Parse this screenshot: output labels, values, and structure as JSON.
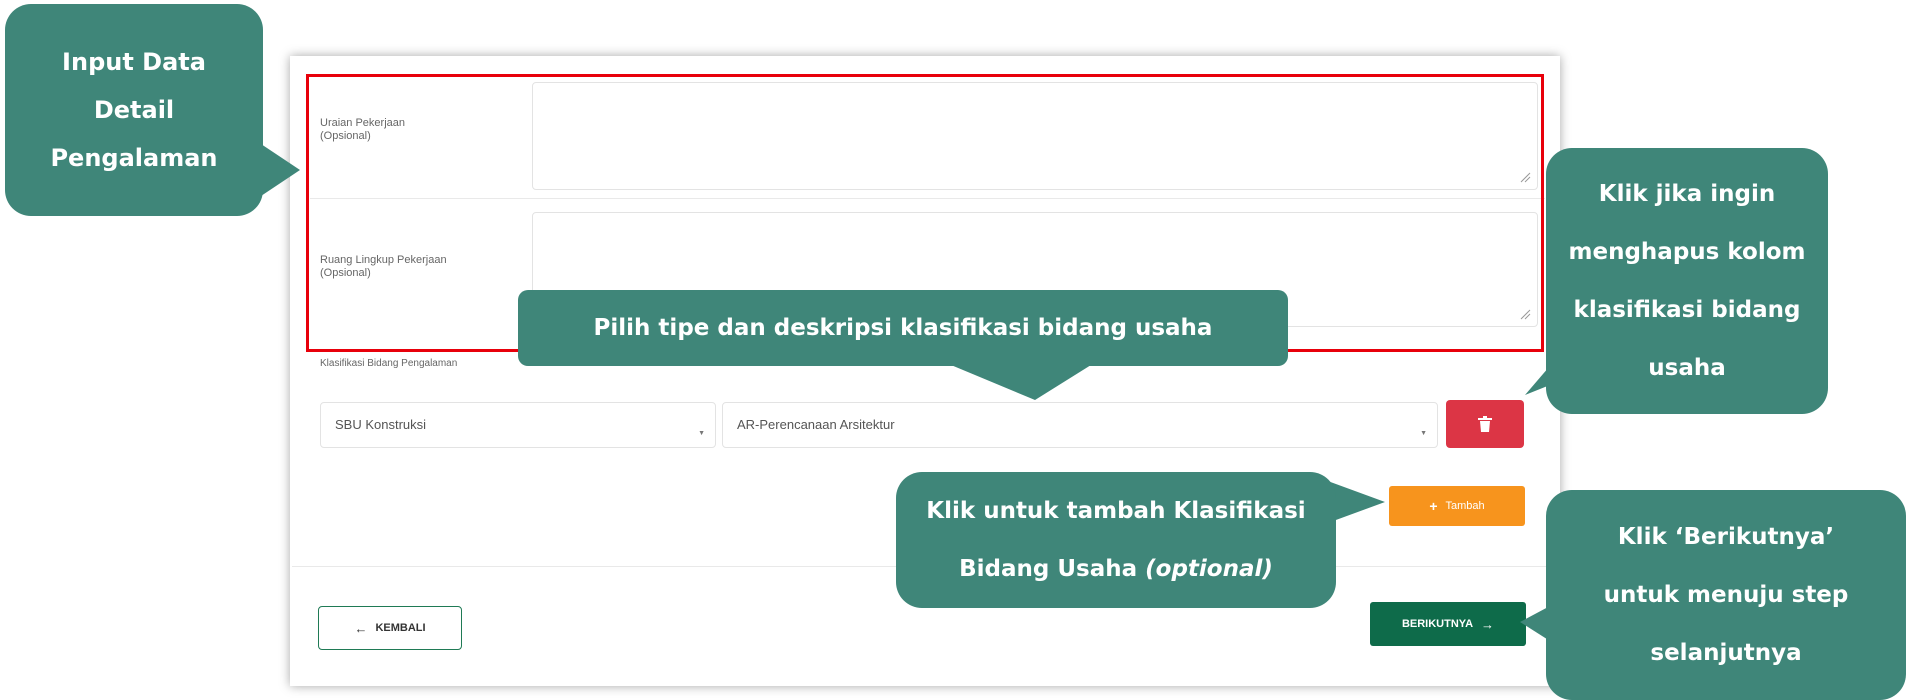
{
  "form": {
    "uraian_label": "Uraian Pekerjaan",
    "uraian_hint": "(Opsional)",
    "uraian_value": "",
    "ruang_label": "Ruang Lingkup Pekerjaan",
    "ruang_hint": "(Opsional)",
    "ruang_value": "",
    "klasifikasi_label": "Klasifikasi Bidang Pengalaman",
    "tipe_selected": "SBU Konstruksi",
    "deskripsi_selected": "AR-Perencanaan Arsitektur",
    "tambah_label": "Tambah",
    "kembali_label": "KEMBALI",
    "berikutnya_label": "BERIKUTNYA"
  },
  "callouts": {
    "input_data": [
      "Input Data",
      "Detail",
      "Pengalaman"
    ],
    "pilih_tipe": "Pilih tipe dan deskripsi klasifikasi bidang usaha",
    "hapus": [
      "Klik jika ingin",
      "menghapus kolom",
      "klasifikasi bidang",
      "usaha"
    ],
    "tambah_line1": "Klik untuk tambah Klasifikasi",
    "tambah_line2": "Bidang Usaha",
    "tambah_optional": "(optional)",
    "berikutnya": [
      "Klik ‘Berikutnya’",
      "untuk menuju step",
      "selanjutnya"
    ]
  },
  "colors": {
    "callout": "#3f8679",
    "highlight": "#e8000b",
    "delete": "#dc3545",
    "tambah": "#f7941d",
    "primary": "#0e6b4a"
  },
  "icons": [
    "trash-icon",
    "plus-icon",
    "arrow-left-icon",
    "arrow-right-icon",
    "resize-grip-icon",
    "caret-down-icon"
  ]
}
